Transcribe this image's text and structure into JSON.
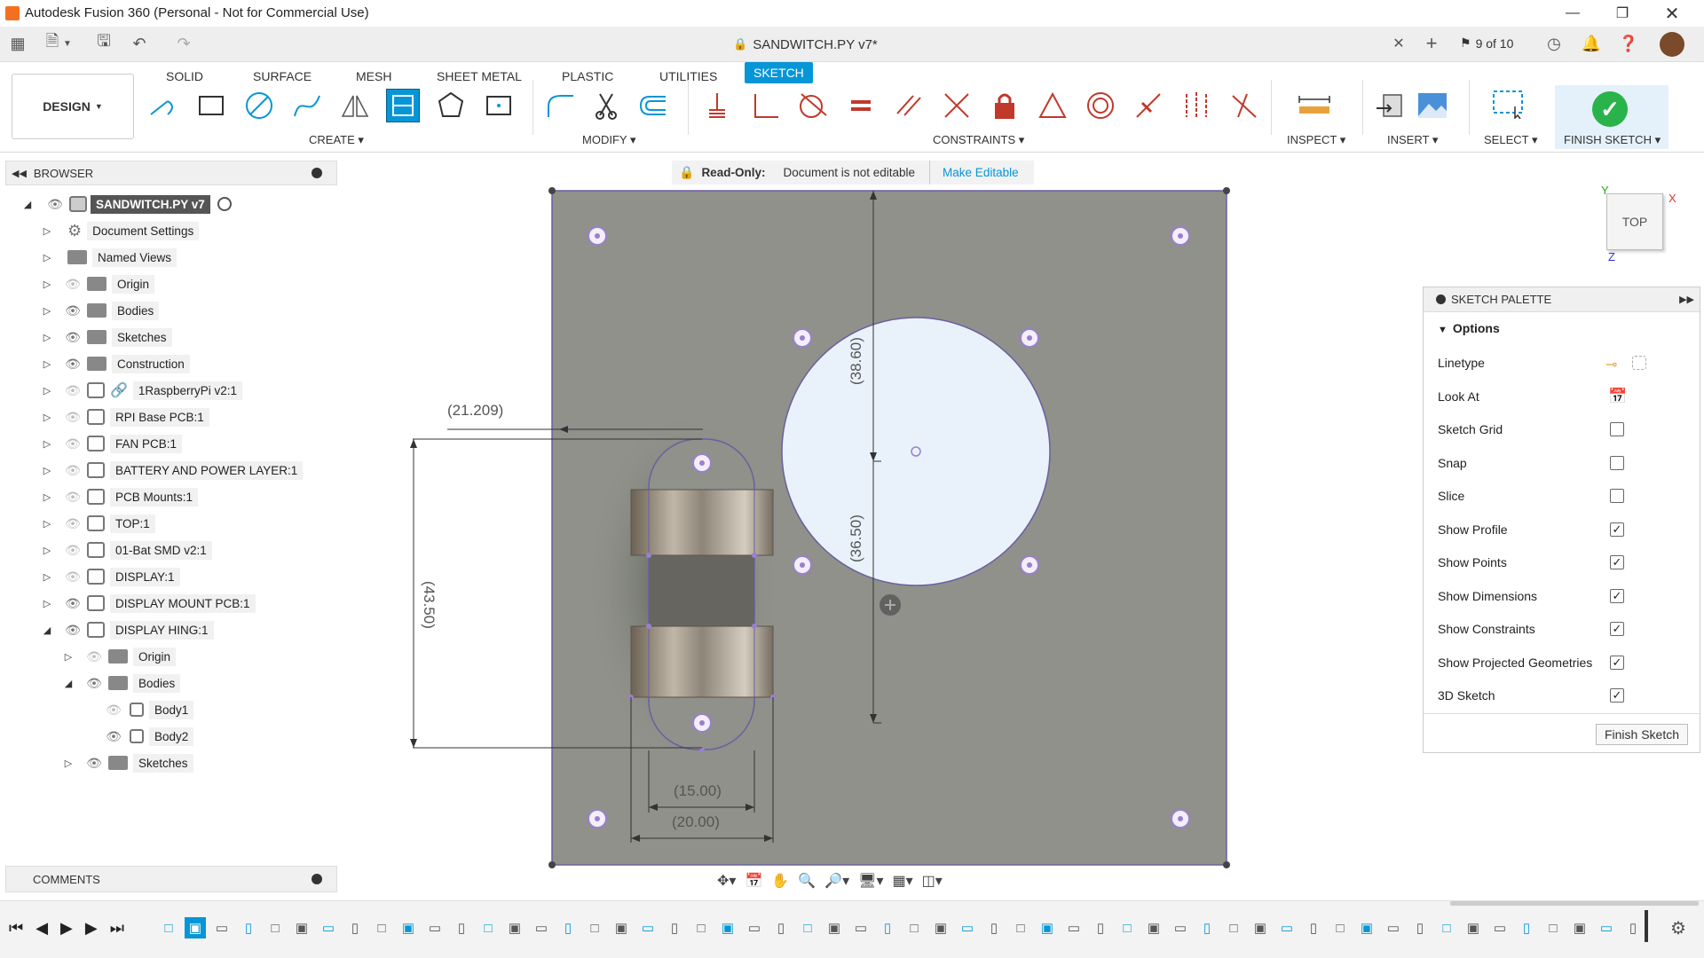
{
  "app": {
    "title": "Autodesk Fusion 360 (Personal - Not for Commercial Use)"
  },
  "document": {
    "tab_title": "SANDWITCH.PY v7*",
    "job_status": "9 of 10"
  },
  "workspace": {
    "label": "DESIGN"
  },
  "ribbon": {
    "tabs": [
      "SOLID",
      "SURFACE",
      "MESH",
      "SHEET METAL",
      "PLASTIC",
      "UTILITIES",
      "SKETCH"
    ],
    "active_tab": "SKETCH",
    "groups": {
      "create": "CREATE",
      "modify": "MODIFY",
      "constraints": "CONSTRAINTS",
      "inspect": "INSPECT",
      "insert": "INSERT",
      "select": "SELECT",
      "finish": "FINISH SKETCH"
    }
  },
  "browser": {
    "title": "BROWSER",
    "root": "SANDWITCH.PY v7",
    "items": [
      {
        "label": "Document Settings"
      },
      {
        "label": "Named Views"
      },
      {
        "label": "Origin"
      },
      {
        "label": "Bodies"
      },
      {
        "label": "Sketches"
      },
      {
        "label": "Construction"
      },
      {
        "label": "1RaspberryPi v2:1"
      },
      {
        "label": "RPI Base PCB:1"
      },
      {
        "label": "FAN PCB:1"
      },
      {
        "label": "BATTERY AND POWER LAYER:1"
      },
      {
        "label": "PCB Mounts:1"
      },
      {
        "label": "TOP:1"
      },
      {
        "label": "01-Bat SMD v2:1"
      },
      {
        "label": "DISPLAY:1"
      },
      {
        "label": "DISPLAY MOUNT PCB:1"
      },
      {
        "label": "DISPLAY HING:1"
      },
      {
        "label": "Origin"
      },
      {
        "label": "Bodies"
      },
      {
        "label": "Body1"
      },
      {
        "label": "Body2"
      },
      {
        "label": "Sketches"
      }
    ],
    "comments": "COMMENTS"
  },
  "readonly_banner": {
    "label": "Read-Only:",
    "message": "Document is not editable",
    "action": "Make Editable"
  },
  "viewcube": {
    "face": "TOP",
    "x": "X",
    "y": "Y",
    "z": "Z"
  },
  "dimensions": {
    "d1": "(21.209)",
    "d2": "(43.50)",
    "d3": "(38.60)",
    "d4": "(36.50)",
    "d5": "(15.00)",
    "d6": "(20.00)"
  },
  "palette": {
    "title": "SKETCH PALETTE",
    "section": "Options",
    "rows": [
      {
        "label": "Linetype"
      },
      {
        "label": "Look At"
      },
      {
        "label": "Sketch Grid",
        "checked": false
      },
      {
        "label": "Snap",
        "checked": false
      },
      {
        "label": "Slice",
        "checked": false
      },
      {
        "label": "Show Profile",
        "checked": true
      },
      {
        "label": "Show Points",
        "checked": true
      },
      {
        "label": "Show Dimensions",
        "checked": true
      },
      {
        "label": "Show Constraints",
        "checked": true
      },
      {
        "label": "Show Projected Geometries",
        "checked": true
      },
      {
        "label": "3D Sketch",
        "checked": true
      }
    ],
    "finish_button": "Finish Sketch"
  },
  "colors": {
    "accent": "#0696d7",
    "plate": "#8f918a",
    "circle_fill": "#e9f2fa",
    "finish_green": "#2ab34a"
  }
}
